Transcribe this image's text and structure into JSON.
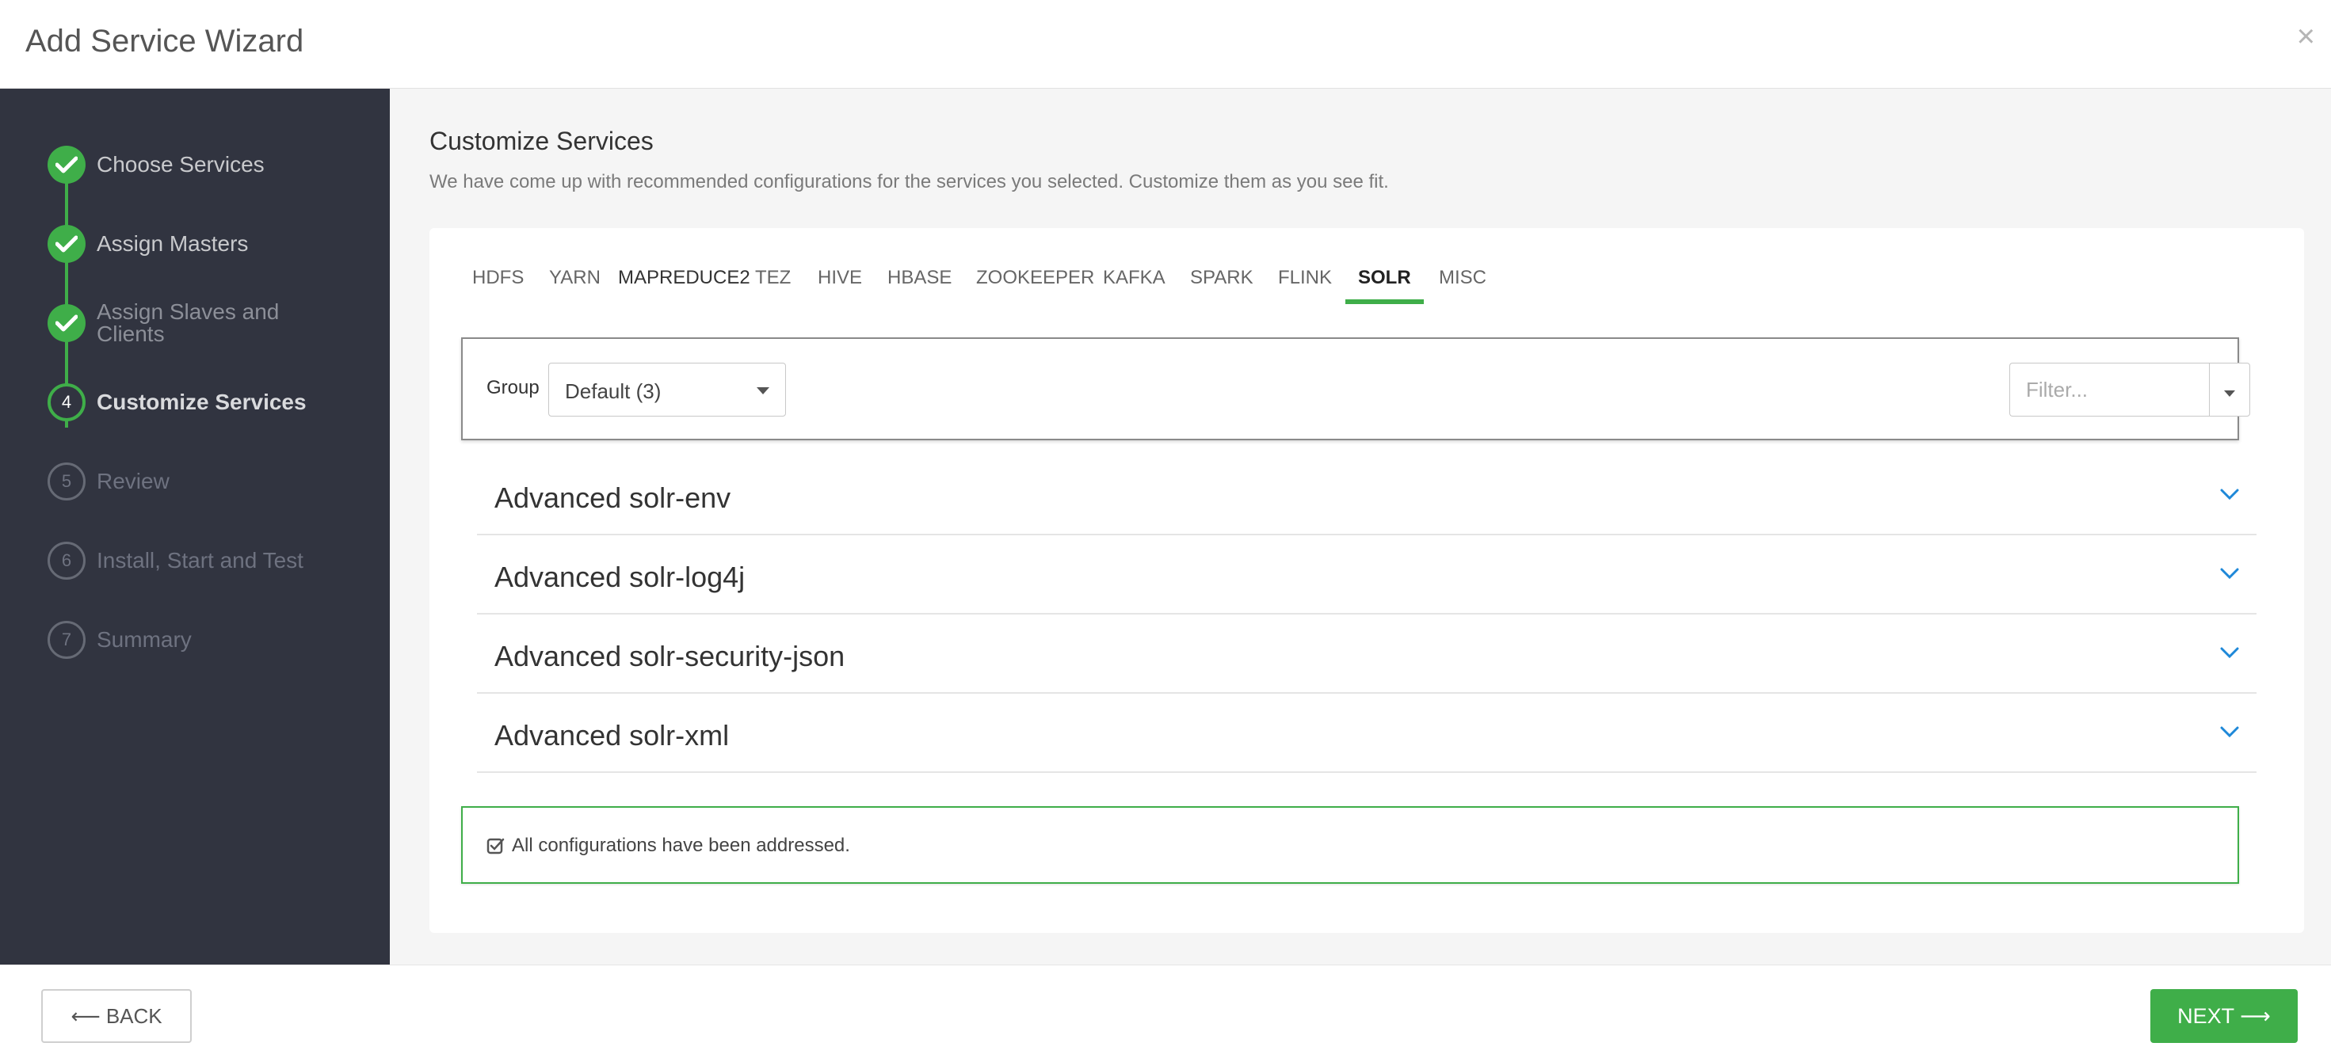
{
  "modal": {
    "title": "Add Service Wizard",
    "close_label": "×"
  },
  "sidebar": {
    "steps": [
      {
        "label": "Choose Services",
        "state": "done"
      },
      {
        "label": "Assign Masters",
        "state": "done"
      },
      {
        "label": "Assign Slaves and Clients",
        "state": "done"
      },
      {
        "number": "4",
        "label": "Customize Services",
        "state": "current"
      },
      {
        "number": "5",
        "label": "Review",
        "state": "pending"
      },
      {
        "number": "6",
        "label": "Install, Start and Test",
        "state": "pending"
      },
      {
        "number": "7",
        "label": "Summary",
        "state": "pending"
      }
    ]
  },
  "main": {
    "title": "Customize Services",
    "subtitle": "We have come up with recommended configurations for the services you selected. Customize them as you see fit.",
    "tabs": [
      "HDFS",
      "YARN",
      "MAPREDUCE2",
      "TEZ",
      "HIVE",
      "HBASE",
      "ZOOKEEPER",
      "KAFKA",
      "SPARK",
      "FLINK",
      "SOLR",
      "MISC"
    ],
    "active_tab": "SOLR",
    "group": {
      "label": "Group",
      "value": "Default (3)"
    },
    "filter": {
      "placeholder": "Filter..."
    },
    "sections": [
      "Advanced solr-env",
      "Advanced solr-log4j",
      "Advanced solr-security-json",
      "Advanced solr-xml"
    ],
    "alert": "All configurations have been addressed."
  },
  "footer": {
    "back_label": "⟵ BACK",
    "next_label": "NEXT ⟶"
  },
  "colors": {
    "accent": "#3fae49",
    "sidebar_bg": "#313440",
    "chevron": "#1e88d8"
  }
}
